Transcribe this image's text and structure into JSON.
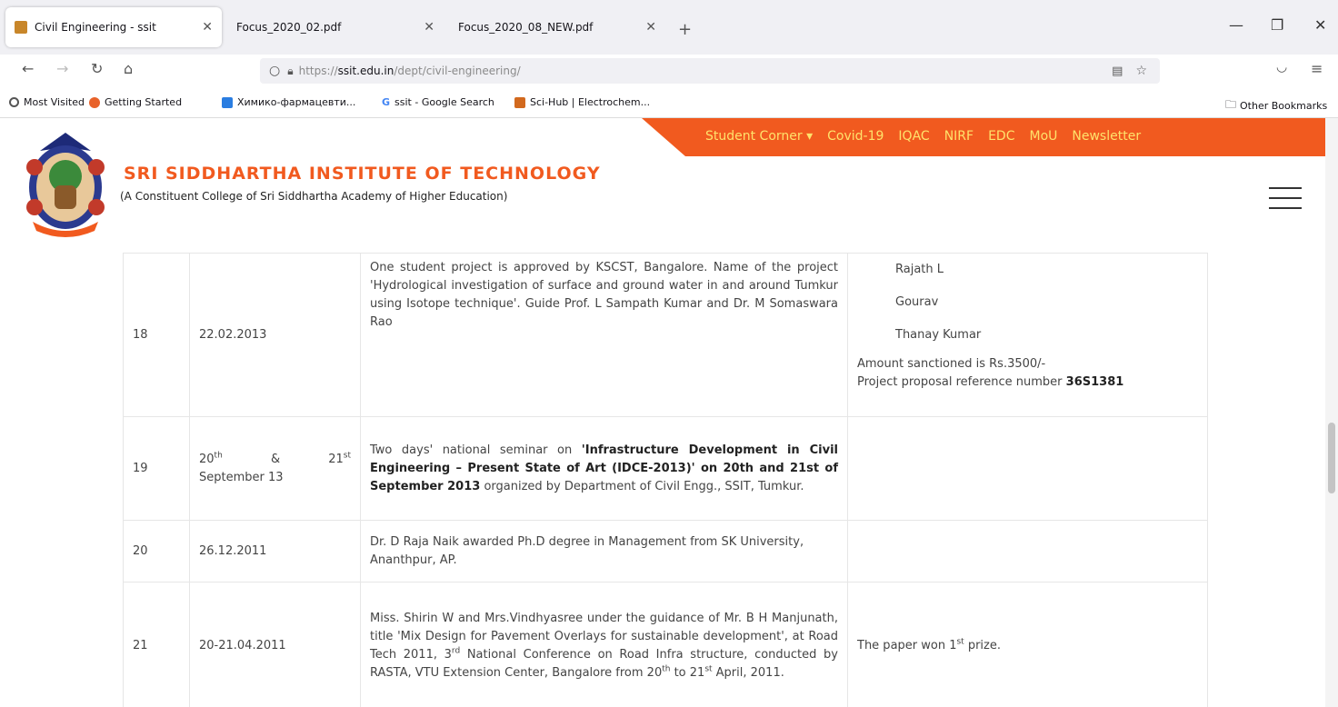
{
  "tabs": [
    {
      "label": "Civil Engineering - ssit"
    },
    {
      "label": "Focus_2020_02.pdf"
    },
    {
      "label": "Focus_2020_08_NEW.pdf"
    }
  ],
  "address": {
    "prefix": "https://",
    "host": "ssit.edu.in",
    "path": "/dept/civil-engineering/"
  },
  "bookmarks": {
    "items": [
      "Most Visited",
      "Getting Started",
      "Химико-фармацевти...",
      "ssit - Google Search",
      "Sci-Hub | Electrochem..."
    ],
    "other": "Other Bookmarks"
  },
  "site": {
    "nav": [
      "Student Corner ▾",
      "Covid-19",
      "IQAC",
      "NIRF",
      "EDC",
      "MoU",
      "Newsletter"
    ],
    "name": "SRI SIDDHARTHA INSTITUTE OF TECHNOLOGY",
    "subtitle": "(A Constituent College of Sri Siddhartha Academy of Higher Education)",
    "accent": "#f15a1f"
  },
  "rows": {
    "r18": {
      "no": "18",
      "date": "22.02.2013",
      "desc": "One student project is approved by KSCST, Bangalore. Name of the project 'Hydrological investigation of surface and ground water in and around Tumkur using Isotope technique'. Guide Prof. L Sampath Kumar and Dr. M Somaswara Rao",
      "names": [
        "Rajath L",
        "Gourav",
        "Thanay Kumar"
      ],
      "amount": "Amount sanctioned is Rs.3500/-",
      "ref_label": "Project proposal reference number",
      "ref_no": "36S1381"
    },
    "r19": {
      "no": "19",
      "date_a": "20",
      "date_a_sup": "th",
      "date_amp": "&",
      "date_b": "21",
      "date_b_sup": "st",
      "date_c": "September 13",
      "desc_pre": "Two days' national seminar on ",
      "desc_bold": "'Infrastructure Development in Civil Engineering – Present State of Art (IDCE-2013)' on 20th and 21st of September 2013",
      "desc_post": " organized by Department of Civil Engg., SSIT, Tumkur."
    },
    "r20": {
      "no": "20",
      "date": "26.12.2011",
      "desc": "Dr. D Raja Naik awarded Ph.D degree in Management from SK University, Ananthpur, AP."
    },
    "r21": {
      "no": "21",
      "date": "20-21.04.2011",
      "desc_1": "Miss. Shirin W and Mrs.Vindhyasree under the guidance of Mr. B H Manjunath, title 'Mix Design for Pavement Overlays for sustainable development', at Road Tech 2011, 3",
      "sup_1": "rd",
      "desc_2": " National Conference on Road Infra structure, conducted by RASTA, VTU Extension Center, Bangalore from 20",
      "sup_2": "th",
      "desc_3": " to 21",
      "sup_3": "st",
      "desc_4": " April, 2011.",
      "result_pre": "The paper won 1",
      "result_sup": "st",
      "result_post": " prize."
    }
  }
}
